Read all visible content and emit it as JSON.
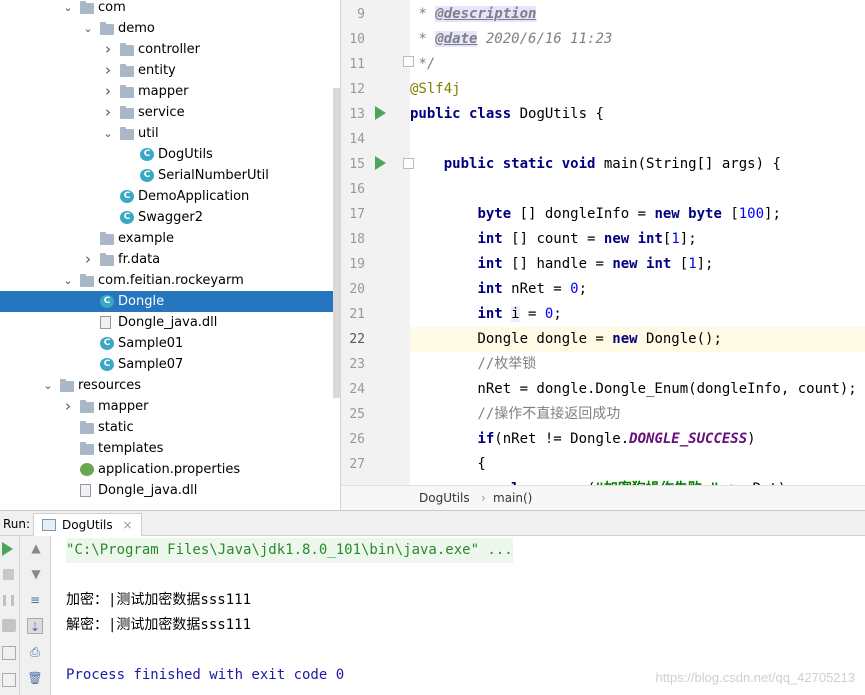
{
  "project_tree": [
    {
      "label": "com",
      "depth": 5,
      "arrow": "down",
      "icon": "folder"
    },
    {
      "label": "demo",
      "depth": 6,
      "arrow": "down",
      "icon": "folder"
    },
    {
      "label": "controller",
      "depth": 7,
      "arrow": "right",
      "icon": "folder"
    },
    {
      "label": "entity",
      "depth": 7,
      "arrow": "right",
      "icon": "folder"
    },
    {
      "label": "mapper",
      "depth": 7,
      "arrow": "right",
      "icon": "folder"
    },
    {
      "label": "service",
      "depth": 7,
      "arrow": "right",
      "icon": "folder"
    },
    {
      "label": "util",
      "depth": 7,
      "arrow": "down",
      "icon": "folder"
    },
    {
      "label": "DogUtils",
      "depth": 8,
      "arrow": "",
      "icon": "class"
    },
    {
      "label": "SerialNumberUtil",
      "depth": 8,
      "arrow": "",
      "icon": "class"
    },
    {
      "label": "DemoApplication",
      "depth": 7,
      "arrow": "",
      "icon": "class"
    },
    {
      "label": "Swagger2",
      "depth": 7,
      "arrow": "",
      "icon": "class"
    },
    {
      "label": "example",
      "depth": 6,
      "arrow": "",
      "icon": "folder"
    },
    {
      "label": "fr.data",
      "depth": 6,
      "arrow": "right",
      "icon": "folder"
    },
    {
      "label": "com.feitian.rockeyarm",
      "depth": 5,
      "arrow": "down",
      "icon": "folder"
    },
    {
      "label": "Dongle",
      "depth": 6,
      "arrow": "",
      "icon": "class",
      "selected": true
    },
    {
      "label": "Dongle_java.dll",
      "depth": 6,
      "arrow": "",
      "icon": "file"
    },
    {
      "label": "Sample01",
      "depth": 6,
      "arrow": "",
      "icon": "class"
    },
    {
      "label": "Sample07",
      "depth": 6,
      "arrow": "",
      "icon": "class"
    },
    {
      "label": "resources",
      "depth": 4,
      "arrow": "down",
      "icon": "folder"
    },
    {
      "label": "mapper",
      "depth": 5,
      "arrow": "right",
      "icon": "folder"
    },
    {
      "label": "static",
      "depth": 5,
      "arrow": "",
      "icon": "folder"
    },
    {
      "label": "templates",
      "depth": 5,
      "arrow": "",
      "icon": "folder"
    },
    {
      "label": "application.properties",
      "depth": 5,
      "arrow": "",
      "icon": "properties"
    },
    {
      "label": "Dongle_java.dll",
      "depth": 5,
      "arrow": "",
      "icon": "file"
    }
  ],
  "editor": {
    "line_numbers": [
      "9",
      "10",
      "11",
      "12",
      "13",
      "14",
      "15",
      "16",
      "17",
      "18",
      "19",
      "20",
      "21",
      "22",
      "23",
      "24",
      "25",
      "26",
      "27"
    ],
    "current_line": "22",
    "breadcrumb": {
      "class_name": "DogUtils",
      "method_name": "main()"
    }
  },
  "run_panel": {
    "label": "Run:",
    "tab_title": "DogUtils",
    "close_glyph": "×",
    "output": {
      "command": "\"C:\\Program Files\\Java\\jdk1.8.0_101\\bin\\java.exe\" ...",
      "line1": "加密：|测试加密数据sss111",
      "line2": "解密：|测试加密数据sss111",
      "exit": "Process finished with exit code 0"
    },
    "watermark": "https://blog.csdn.net/qq_42705213"
  },
  "colors": {
    "selection": "#2675bf",
    "keyword": "#000080",
    "run_green": "#4ca65a"
  }
}
